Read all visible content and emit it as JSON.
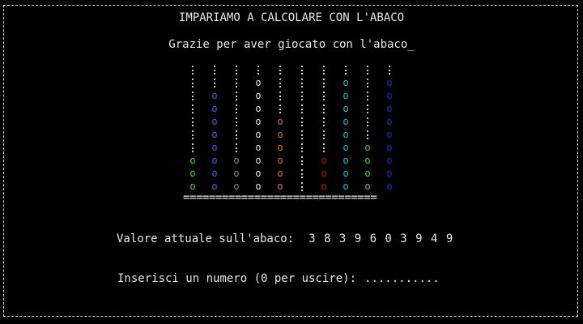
{
  "title": "IMPARIAMO A CALCOLARE CON L'ABACO",
  "message": "Grazie per aver giocato con l'abaco_",
  "abacus": {
    "columns": [
      {
        "beads": 3,
        "color": "#44d844"
      },
      {
        "beads": 8,
        "color": "#5a5aff"
      },
      {
        "beads": 3,
        "color": "#8a8a8a"
      },
      {
        "beads": 9,
        "color": "#e0e0e0"
      },
      {
        "beads": 6,
        "color": "#e07820"
      },
      {
        "beads": 0,
        "color": "#e0e0e0"
      },
      {
        "beads": 3,
        "color": "#cc1010"
      },
      {
        "beads": 9,
        "color": "#20c0c0"
      },
      {
        "beads": 4,
        "color": "#44d844"
      },
      {
        "beads": 9,
        "color": "#2828d0"
      }
    ],
    "base": "=============================="
  },
  "value_label": "Valore attuale sull'abaco:",
  "value_digits": "3 8 3 9 6 0 3 9 4 9",
  "prompt": {
    "label": "Inserisci un numero (0 per uscire):",
    "input": "..........."
  }
}
